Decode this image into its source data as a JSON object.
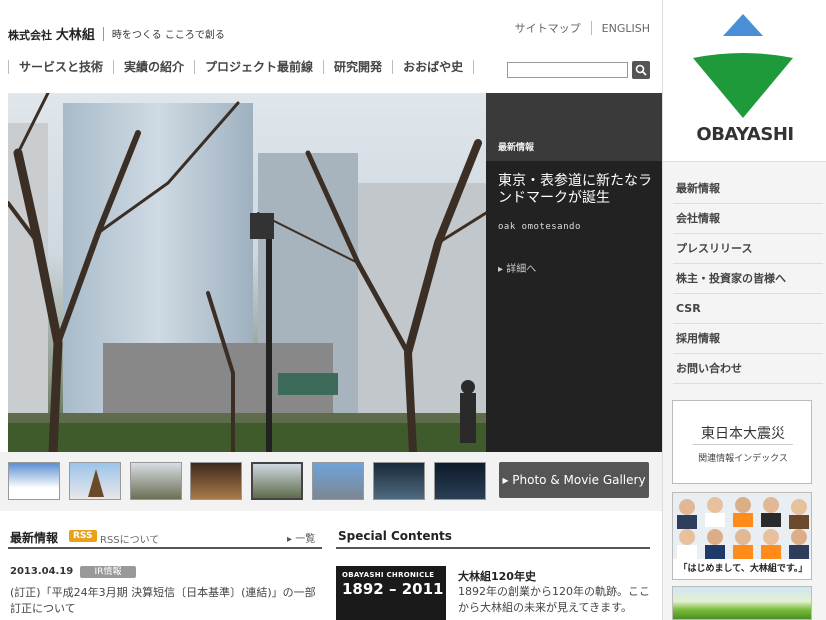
{
  "header": {
    "company_prefix": "株式会社",
    "company_name": "大林組",
    "tagline": "時をつくる こころで創る",
    "utility": [
      "サイトマップ",
      "ENGLISH"
    ],
    "nav": [
      "サービスと技術",
      "実績の紹介",
      "プロジェクト最前線",
      "研究開発",
      "おおばや史"
    ],
    "search_placeholder": ""
  },
  "feature": {
    "label": "最新情報",
    "title": "東京・表参道に新たなランドマークが誕生",
    "subtitle": "oak omotesando",
    "more": "▸ 詳細へ"
  },
  "gallery_button": "▸ Photo & Movie Gallery",
  "news": {
    "heading": "最新情報",
    "rss_badge": "RSS",
    "rss_link": "RSSについて",
    "list_link": "▸ 一覧",
    "date": "2013.04.19",
    "category": "IR情報",
    "text": "(訂正)「平成24年3月期 決算短信〔日本基準〕(連結)」の一部訂正について"
  },
  "special": {
    "heading": "Special Contents",
    "chronicle_label": "OBAYASHI CHRONICLE",
    "chronicle_years": "1892 – 2011",
    "title": "大林組120年史",
    "text": "1892年の創業から120年の軌跡。ここから大林組の未来が見えてきます。"
  },
  "sidebar": {
    "brand": "OBAYASHI",
    "nav": [
      "最新情報",
      "会社情報",
      "プレスリリース",
      "株主・投資家の皆様へ",
      "CSR",
      "採用情報",
      "お問い合わせ"
    ],
    "quake_title": "東日本大震災",
    "quake_sub": "関連情報インデックス",
    "people_caption": "「はじめまして、大林組です。」"
  },
  "colors": {
    "brand_green": "#1e9a3a",
    "brand_blue": "#4a8fd6",
    "rss_orange": "#e8a21a",
    "feature_bg": "#222222"
  }
}
